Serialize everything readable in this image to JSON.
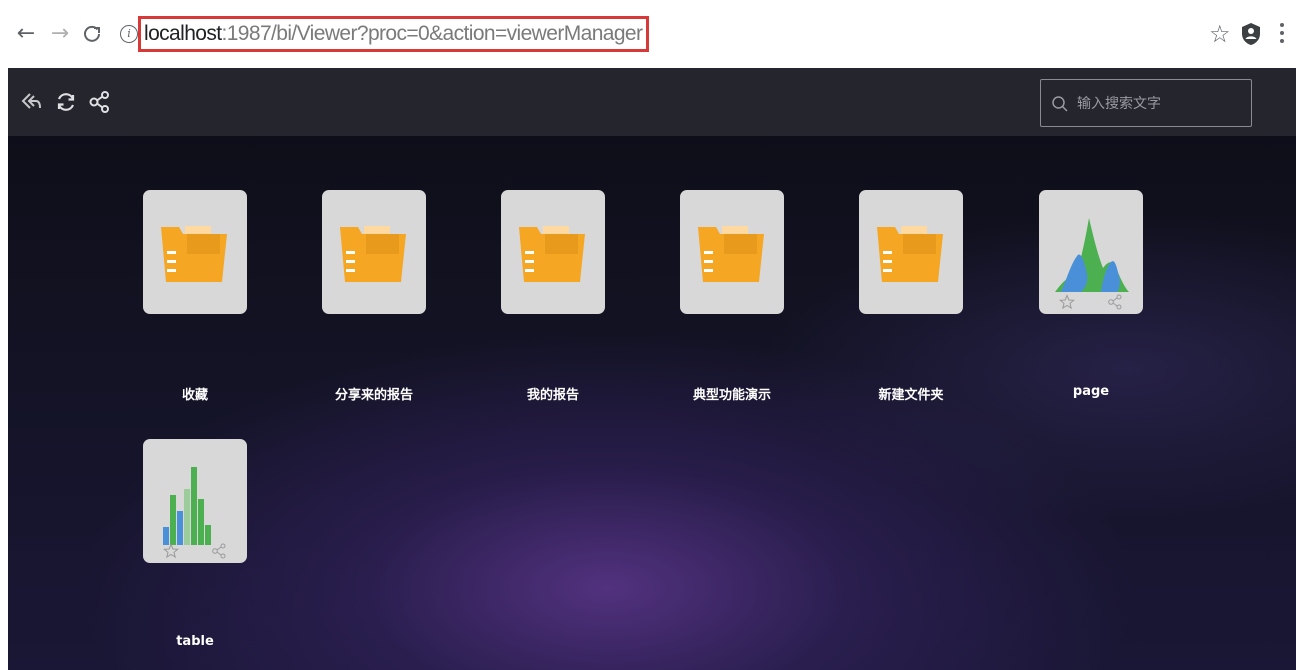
{
  "browser": {
    "url_host": "localhost",
    "url_path": ":1987/bi/Viewer?proc=0&action=viewerManager",
    "back_icon": "←",
    "forward_icon": "→",
    "reload_icon": "C",
    "info_icon": "i",
    "star_icon": "☆"
  },
  "toolbar": {
    "search_placeholder": "输入搜索文字"
  },
  "tiles": [
    {
      "label": "收藏",
      "kind": "folder"
    },
    {
      "label": "分享来的报告",
      "kind": "folder"
    },
    {
      "label": "我的报告",
      "kind": "folder"
    },
    {
      "label": "典型功能演示",
      "kind": "folder"
    },
    {
      "label": "新建文件夹",
      "kind": "folder"
    },
    {
      "label": "page",
      "kind": "area-chart-report"
    },
    {
      "label": "table",
      "kind": "bar-chart-report"
    }
  ],
  "colors": {
    "folder": "#f5a623",
    "chart_green": "#4caf50",
    "chart_blue": "#4a90d9",
    "chart_light_green": "#9ccc9c",
    "url_highlight": "#d93838"
  }
}
